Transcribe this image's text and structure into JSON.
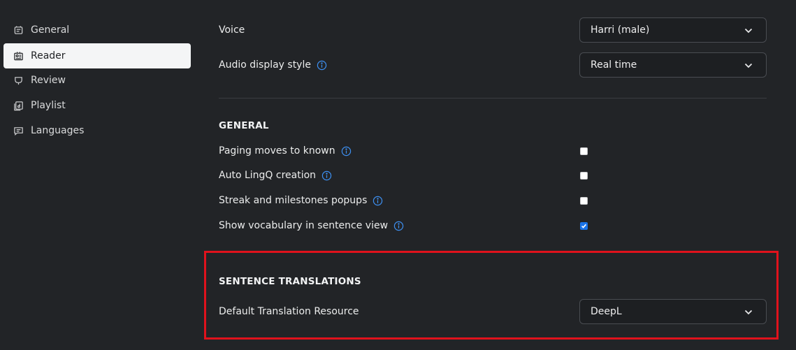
{
  "sidebar": {
    "items": [
      {
        "label": "General",
        "icon": "badge-icon",
        "active": false
      },
      {
        "label": "Reader",
        "icon": "reader-icon",
        "active": true
      },
      {
        "label": "Review",
        "icon": "review-icon",
        "active": false
      },
      {
        "label": "Playlist",
        "icon": "playlist-icon",
        "active": false
      },
      {
        "label": "Languages",
        "icon": "chat-icon",
        "active": false
      }
    ]
  },
  "audio": {
    "voice_label": "Voice",
    "voice_value": "Harri (male)",
    "display_style_label": "Audio display style",
    "display_style_value": "Real time"
  },
  "general": {
    "title": "GENERAL",
    "options": [
      {
        "label": "Paging moves to known",
        "checked": false
      },
      {
        "label": "Auto LingQ creation",
        "checked": false
      },
      {
        "label": "Streak and milestones popups",
        "checked": false
      },
      {
        "label": "Show vocabulary in sentence view",
        "checked": true
      }
    ]
  },
  "sentence_translations": {
    "title": "SENTENCE TRANSLATIONS",
    "resource_label": "Default Translation Resource",
    "resource_value": "DeepL"
  },
  "colors": {
    "background": "#222427",
    "active_nav": "#f4f5f6",
    "info_icon": "#3d8ff0",
    "checkbox_checked": "#1a73e8",
    "highlight": "#e0121c"
  }
}
